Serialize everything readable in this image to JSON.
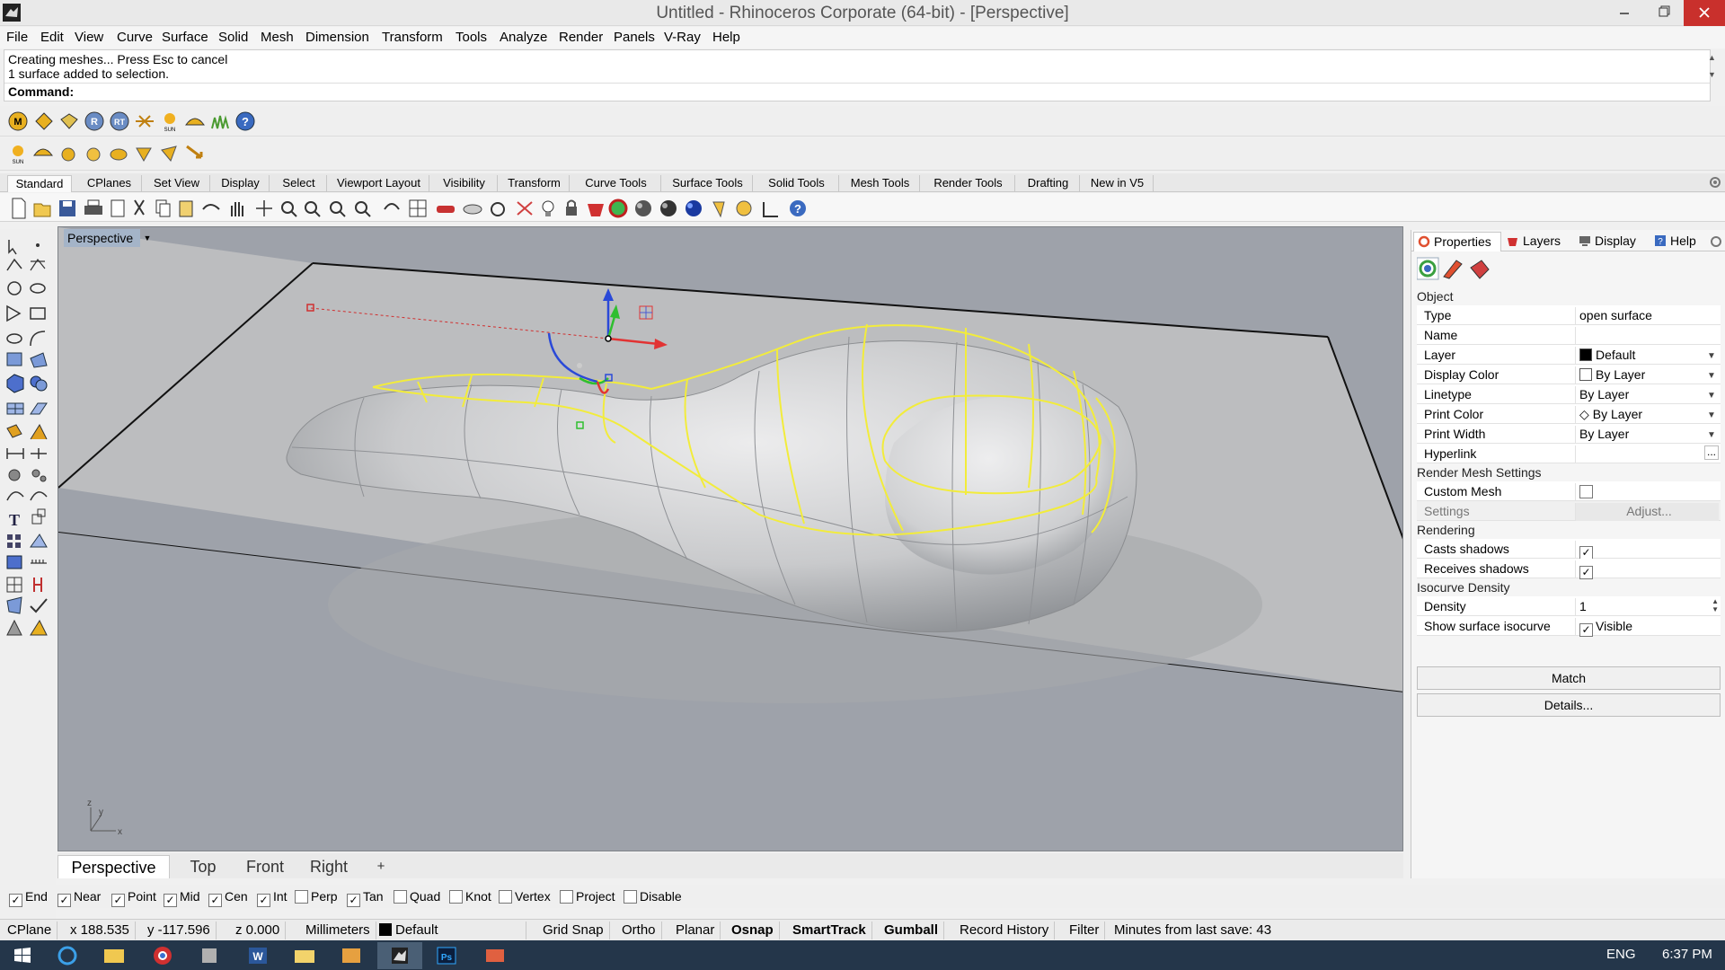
{
  "window": {
    "title": "Untitled - Rhinoceros Corporate (64-bit) - [Perspective]",
    "minimize_icon": "minimize-icon",
    "maximize_icon": "restore-icon",
    "close_icon": "close-icon"
  },
  "menu": [
    "File",
    "Edit",
    "View",
    "Curve",
    "Surface",
    "Solid",
    "Mesh",
    "Dimension",
    "Transform",
    "Tools",
    "Analyze",
    "Render",
    "Panels",
    "V-Ray",
    "Help"
  ],
  "command": {
    "history": [
      "Creating meshes... Press Esc to cancel",
      "1 surface added to selection."
    ],
    "prompt_label": "Command:",
    "input_value": ""
  },
  "tabs": [
    "Standard",
    "CPlanes",
    "Set View",
    "Display",
    "Select",
    "Viewport Layout",
    "Visibility",
    "Transform",
    "Curve Tools",
    "Surface Tools",
    "Solid Tools",
    "Mesh Tools",
    "Render Tools",
    "Drafting",
    "New in V5"
  ],
  "viewport": {
    "label": "Perspective",
    "axis_x": "x",
    "axis_y": "y",
    "axis_z": "z",
    "colors": {
      "background": "#9ea2aa",
      "plane": "#bcbdbf",
      "surface": "#d8d9db",
      "selection": "#f2ec3b",
      "gumball_x": "#e23333",
      "gumball_y": "#2fbf2f",
      "gumball_z": "#2a49d8"
    }
  },
  "view_tabs": [
    "Perspective",
    "Top",
    "Front",
    "Right"
  ],
  "view_tabs_add": "+",
  "osnaps": [
    {
      "label": "End",
      "checked": true
    },
    {
      "label": "Near",
      "checked": true
    },
    {
      "label": "Point",
      "checked": true
    },
    {
      "label": "Mid",
      "checked": true
    },
    {
      "label": "Cen",
      "checked": true
    },
    {
      "label": "Int",
      "checked": true
    },
    {
      "label": "Perp",
      "checked": false
    },
    {
      "label": "Tan",
      "checked": true
    },
    {
      "label": "Quad",
      "checked": false
    },
    {
      "label": "Knot",
      "checked": false
    },
    {
      "label": "Vertex",
      "checked": false
    },
    {
      "label": "Project",
      "checked": false
    },
    {
      "label": "Disable",
      "checked": false
    }
  ],
  "status": {
    "cplane": "CPlane",
    "x": "x 188.535",
    "y": "y -117.596",
    "z": "z 0.000",
    "units": "Millimeters",
    "layer": "Default",
    "grid_snap": "Grid Snap",
    "ortho": "Ortho",
    "planar": "Planar",
    "osnap": "Osnap",
    "smarttrack": "SmartTrack",
    "gumball": "Gumball",
    "record_history": "Record History",
    "filter": "Filter",
    "save_info": "Minutes from last save: 43"
  },
  "panel": {
    "tabs": [
      "Properties",
      "Layers",
      "Display",
      "Help"
    ],
    "section_object": "Object",
    "props": [
      {
        "name": "Type",
        "value": "open surface",
        "swatch": "",
        "dropdown": false
      },
      {
        "name": "Name",
        "value": "",
        "swatch": "",
        "dropdown": false
      },
      {
        "name": "Layer",
        "value": "Default",
        "swatch": "#000000",
        "dropdown": true
      },
      {
        "name": "Display Color",
        "value": "By Layer",
        "swatch": "#ffffff",
        "dropdown": true
      },
      {
        "name": "Linetype",
        "value": "By Layer",
        "swatch": "",
        "dropdown": true
      },
      {
        "name": "Print Color",
        "value": "By Layer",
        "swatch": "diamond",
        "dropdown": true
      },
      {
        "name": "Print Width",
        "value": "By Layer",
        "swatch": "",
        "dropdown": true
      },
      {
        "name": "Hyperlink",
        "value": "",
        "swatch": "",
        "dropdown": false
      }
    ],
    "hyperlink_button": "...",
    "section_render_mesh": "Render Mesh Settings",
    "custom_mesh_label": "Custom Mesh",
    "custom_mesh_checked": false,
    "settings_label": "Settings",
    "adjust_button": "Adjust...",
    "section_rendering": "Rendering",
    "casts_shadows_label": "Casts shadows",
    "casts_shadows_checked": true,
    "receives_shadows_label": "Receives shadows",
    "receives_shadows_checked": true,
    "section_isocurve": "Isocurve Density",
    "density_label": "Density",
    "density_value": "1",
    "show_isocurve_label": "Show surface isocurve",
    "visible_label": "Visible",
    "visible_checked": true,
    "match_button": "Match",
    "details_button": "Details..."
  },
  "taskbar": {
    "lang": "ENG",
    "time": "6:37 PM",
    "apps": [
      "start-icon",
      "ie-icon",
      "explorer-icon",
      "chrome-icon",
      "app-icon",
      "word-icon",
      "folder-icon",
      "media-icon",
      "rhino-icon",
      "photoshop-icon",
      "mail-icon"
    ]
  }
}
